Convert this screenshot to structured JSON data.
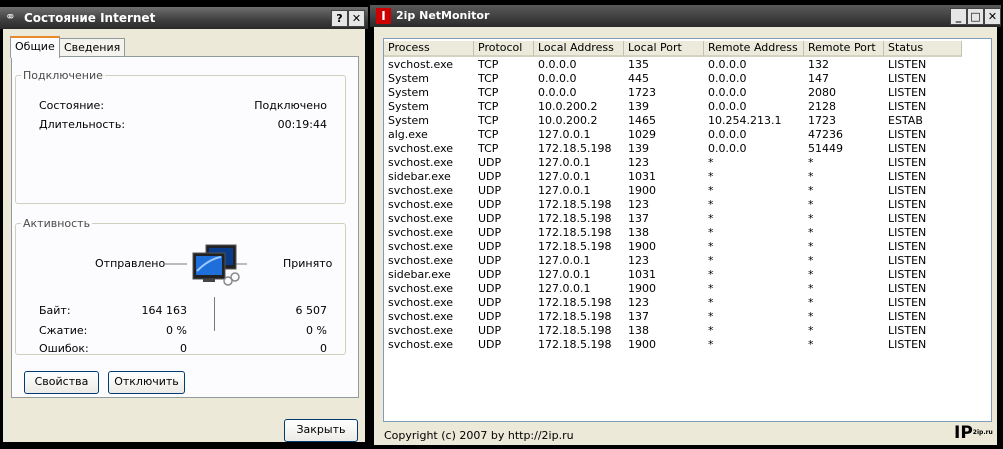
{
  "left_window": {
    "title": "Состояние Internet",
    "help_btn": "?",
    "close_btn": "✕",
    "tabs": [
      {
        "label": "Общие"
      },
      {
        "label": "Сведения"
      }
    ],
    "connection": {
      "legend": "Подключение",
      "status_label": "Состояние:",
      "status_value": "Подключено",
      "duration_label": "Длительность:",
      "duration_value": "00:19:44"
    },
    "activity": {
      "legend": "Активность",
      "sent_label": "Отправлено",
      "received_label": "Принято",
      "bytes_label": "Байт:",
      "bytes_sent": "164 163",
      "bytes_received": "6 507",
      "compression_label": "Сжатие:",
      "compression_sent": "0 %",
      "compression_received": "0 %",
      "errors_label": "Ошибок:",
      "errors_sent": "0",
      "errors_received": "0"
    },
    "properties_btn": "Свойства",
    "disconnect_btn": "Отключить",
    "close_button_label": "Закрыть"
  },
  "right_window": {
    "title": "2ip NetMonitor",
    "logo_letter": "I",
    "columns": [
      "Process",
      "Protocol",
      "Local Address",
      "Local Port",
      "Remote Address",
      "Remote Port",
      "Status"
    ],
    "rows": [
      [
        "svchost.exe",
        "TCP",
        "0.0.0.0",
        "135",
        "0.0.0.0",
        "132",
        "LISTEN"
      ],
      [
        "System",
        "TCP",
        "0.0.0.0",
        "445",
        "0.0.0.0",
        "147",
        "LISTEN"
      ],
      [
        "System",
        "TCP",
        "0.0.0.0",
        "1723",
        "0.0.0.0",
        "2080",
        "LISTEN"
      ],
      [
        "System",
        "TCP",
        "10.0.200.2",
        "139",
        "0.0.0.0",
        "2128",
        "LISTEN"
      ],
      [
        "System",
        "TCP",
        "10.0.200.2",
        "1465",
        "10.254.213.1",
        "1723",
        "ESTAB"
      ],
      [
        "alg.exe",
        "TCP",
        "127.0.0.1",
        "1029",
        "0.0.0.0",
        "47236",
        "LISTEN"
      ],
      [
        "svchost.exe",
        "TCP",
        "172.18.5.198",
        "139",
        "0.0.0.0",
        "51449",
        "LISTEN"
      ],
      [
        "svchost.exe",
        "UDP",
        "127.0.0.1",
        "123",
        "*",
        "*",
        "LISTEN"
      ],
      [
        "sidebar.exe",
        "UDP",
        "127.0.0.1",
        "1031",
        "*",
        "*",
        "LISTEN"
      ],
      [
        "svchost.exe",
        "UDP",
        "127.0.0.1",
        "1900",
        "*",
        "*",
        "LISTEN"
      ],
      [
        "svchost.exe",
        "UDP",
        "172.18.5.198",
        "123",
        "*",
        "*",
        "LISTEN"
      ],
      [
        "svchost.exe",
        "UDP",
        "172.18.5.198",
        "137",
        "*",
        "*",
        "LISTEN"
      ],
      [
        "svchost.exe",
        "UDP",
        "172.18.5.198",
        "138",
        "*",
        "*",
        "LISTEN"
      ],
      [
        "svchost.exe",
        "UDP",
        "172.18.5.198",
        "1900",
        "*",
        "*",
        "LISTEN"
      ],
      [
        "svchost.exe",
        "UDP",
        "127.0.0.1",
        "123",
        "*",
        "*",
        "LISTEN"
      ],
      [
        "sidebar.exe",
        "UDP",
        "127.0.0.1",
        "1031",
        "*",
        "*",
        "LISTEN"
      ],
      [
        "svchost.exe",
        "UDP",
        "127.0.0.1",
        "1900",
        "*",
        "*",
        "LISTEN"
      ],
      [
        "svchost.exe",
        "UDP",
        "172.18.5.198",
        "123",
        "*",
        "*",
        "LISTEN"
      ],
      [
        "svchost.exe",
        "UDP",
        "172.18.5.198",
        "137",
        "*",
        "*",
        "LISTEN"
      ],
      [
        "svchost.exe",
        "UDP",
        "172.18.5.198",
        "138",
        "*",
        "*",
        "LISTEN"
      ],
      [
        "svchost.exe",
        "UDP",
        "172.18.5.198",
        "1900",
        "*",
        "*",
        "LISTEN"
      ]
    ],
    "copyright": "Copyright (c) 2007 by http://2ip.ru",
    "logo_text": "IP",
    "logo_sup": "2ip.ru"
  }
}
